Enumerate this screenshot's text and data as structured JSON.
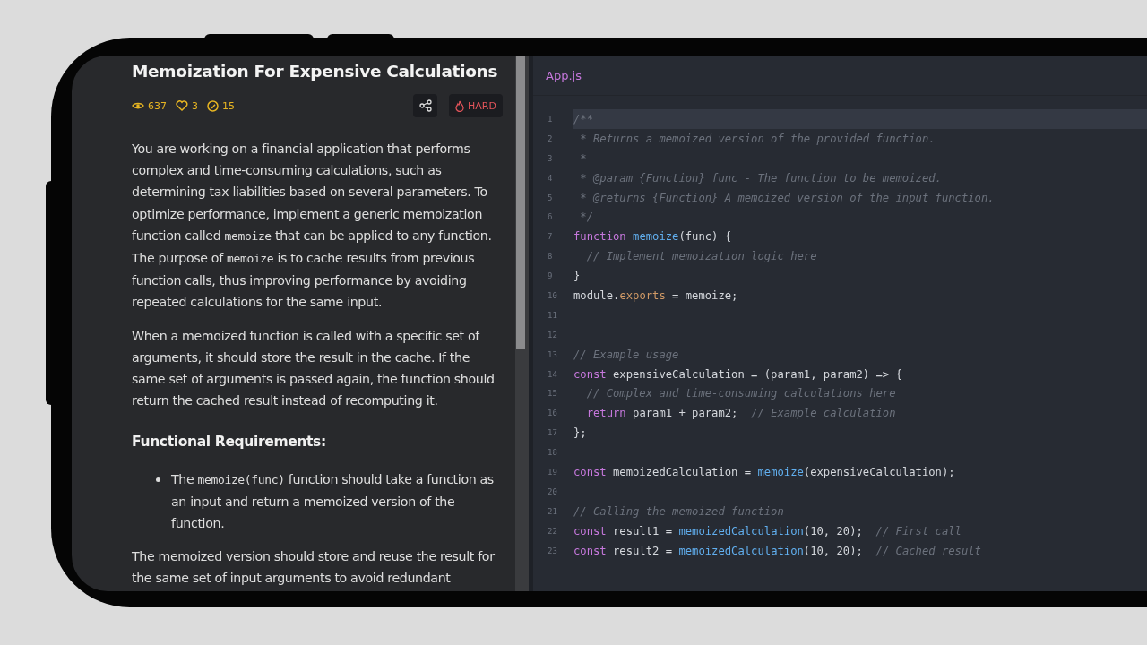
{
  "problem": {
    "title": "Memoization For Expensive Calculations",
    "stats": [
      {
        "kind": "views",
        "value": "637"
      },
      {
        "kind": "likes",
        "value": "3"
      },
      {
        "kind": "solved",
        "value": "15"
      }
    ],
    "difficulty": "HARD",
    "content": [
      {
        "kind": "paragraph",
        "segments": [
          {
            "kind": "text",
            "text": "You are working on a financial application that performs complex and time-consuming calculations, such as determining tax liabilities based on several parameters. To optimize performance, implement a generic memoization function called "
          },
          {
            "kind": "code",
            "text": "memoize"
          },
          {
            "kind": "text",
            "text": " that can be applied to any function. The purpose of "
          },
          {
            "kind": "code",
            "text": "memoize"
          },
          {
            "kind": "text",
            "text": " is to cache results from previous function calls, thus improving performance by avoiding repeated calculations for the same input."
          }
        ]
      },
      {
        "kind": "paragraph",
        "segments": [
          {
            "kind": "text",
            "text": "When a memoized function is called with a specific set of arguments, it should store the result in the cache. If the same set of arguments is passed again, the function should return the cached result instead of recomputing it."
          }
        ]
      },
      {
        "kind": "heading",
        "segments": [
          {
            "kind": "text",
            "text": "Functional Requirements:"
          }
        ]
      },
      {
        "kind": "bullet",
        "segments": [
          {
            "kind": "text",
            "text": "The "
          },
          {
            "kind": "code",
            "text": "memoize(func)"
          },
          {
            "kind": "text",
            "text": " function should take a function as an input and return a memoized version of the function."
          }
        ]
      },
      {
        "kind": "paragraph",
        "segments": [
          {
            "kind": "text",
            "text": "The memoized version should store and reuse the result for the same set of input arguments to avoid redundant"
          }
        ]
      }
    ]
  },
  "editor": {
    "tab": "App.js",
    "lines": [
      {
        "number": "1",
        "highlighted": true,
        "tokens": [
          {
            "kind": "comment",
            "text": "/**"
          }
        ]
      },
      {
        "number": "2",
        "highlighted": false,
        "tokens": [
          {
            "kind": "comment",
            "text": " * Returns a memoized version of the provided function."
          }
        ]
      },
      {
        "number": "3",
        "highlighted": false,
        "tokens": [
          {
            "kind": "comment",
            "text": " *"
          }
        ]
      },
      {
        "number": "4",
        "highlighted": false,
        "tokens": [
          {
            "kind": "comment",
            "text": " * @param {Function} func - The function to be memoized."
          }
        ]
      },
      {
        "number": "5",
        "highlighted": false,
        "tokens": [
          {
            "kind": "comment",
            "text": " * @returns {Function} A memoized version of the input function."
          }
        ]
      },
      {
        "number": "6",
        "highlighted": false,
        "tokens": [
          {
            "kind": "comment",
            "text": " */"
          }
        ]
      },
      {
        "number": "7",
        "highlighted": false,
        "tokens": [
          {
            "kind": "keyword",
            "text": "function "
          },
          {
            "kind": "function",
            "text": "memoize"
          },
          {
            "kind": "plain",
            "text": "(func) {"
          }
        ]
      },
      {
        "number": "8",
        "highlighted": false,
        "tokens": [
          {
            "kind": "comment",
            "text": "  // Implement memoization logic here"
          }
        ]
      },
      {
        "number": "9",
        "highlighted": false,
        "tokens": [
          {
            "kind": "plain",
            "text": "}"
          }
        ]
      },
      {
        "number": "10",
        "highlighted": false,
        "tokens": [
          {
            "kind": "plain",
            "text": "module."
          },
          {
            "kind": "property",
            "text": "exports"
          },
          {
            "kind": "plain",
            "text": " = memoize;"
          }
        ]
      },
      {
        "number": "11"
      },
      {
        "number": "12"
      },
      {
        "number": "13",
        "highlighted": false,
        "tokens": [
          {
            "kind": "comment",
            "text": "// Example usage"
          }
        ]
      },
      {
        "number": "14",
        "highlighted": false,
        "tokens": [
          {
            "kind": "keyword",
            "text": "const"
          },
          {
            "kind": "plain",
            "text": " expensiveCalculation = (param1, param2) => {"
          }
        ]
      },
      {
        "number": "15",
        "highlighted": false,
        "tokens": [
          {
            "kind": "comment",
            "text": "  // Complex and time-consuming calculations here"
          }
        ]
      },
      {
        "number": "16",
        "highlighted": false,
        "tokens": [
          {
            "kind": "keyword",
            "text": "  return"
          },
          {
            "kind": "plain",
            "text": " param1 + param2;  "
          },
          {
            "kind": "comment",
            "text": "// Example calculation"
          }
        ]
      },
      {
        "number": "17",
        "highlighted": false,
        "tokens": [
          {
            "kind": "plain",
            "text": "};"
          }
        ]
      },
      {
        "number": "18"
      },
      {
        "number": "19",
        "highlighted": false,
        "tokens": [
          {
            "kind": "keyword",
            "text": "const"
          },
          {
            "kind": "plain",
            "text": " memoizedCalculation = "
          },
          {
            "kind": "function",
            "text": "memoize"
          },
          {
            "kind": "plain",
            "text": "(expensiveCalculation);"
          }
        ]
      },
      {
        "number": "20"
      },
      {
        "number": "21",
        "highlighted": false,
        "tokens": [
          {
            "kind": "comment",
            "text": "// Calling the memoized function"
          }
        ]
      },
      {
        "number": "22",
        "highlighted": false,
        "tokens": [
          {
            "kind": "keyword",
            "text": "const"
          },
          {
            "kind": "plain",
            "text": " result1 = "
          },
          {
            "kind": "function",
            "text": "memoizedCalculation"
          },
          {
            "kind": "plain",
            "text": "(10, 20);  "
          },
          {
            "kind": "comment",
            "text": "// First call"
          }
        ]
      },
      {
        "number": "23",
        "highlighted": false,
        "tokens": [
          {
            "kind": "keyword",
            "text": "const"
          },
          {
            "kind": "plain",
            "text": " result2 = "
          },
          {
            "kind": "function",
            "text": "memoizedCalculation"
          },
          {
            "kind": "plain",
            "text": "(10, 20);  "
          },
          {
            "kind": "comment",
            "text": "// Cached result"
          }
        ]
      }
    ]
  }
}
